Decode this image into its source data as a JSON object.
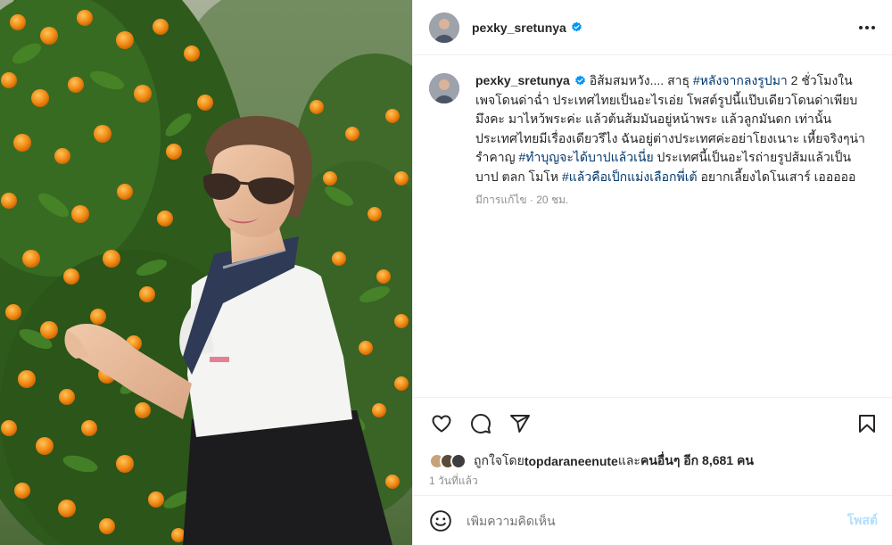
{
  "post": {
    "username": "pexky_sretunya",
    "verified": true
  },
  "caption": {
    "username": "pexky_sretunya",
    "seg1": " อิส้มสมหวัง.... สาธุ ",
    "tag1": "#หลังจากลงรูปมา",
    "seg2": " 2 ชั่วโมงในเพจโดนด่าฉ่ำ ประเทศไทยเป็นอะไรเอ่ย โพสต์รูปนี้แป๊บเดียวโดนด่าเพียบ มึงคะ มาไหว้พระค่ะ แล้วต้นส้มมันอยู่หน้าพระ แล้วลูกมันดก เท่านั้น ประเทศไทยมีเรื่องเดียวรึไง ฉันอยู่ต่างประเทศค่ะอย่าโยงเนาะ เหี้ยจริงๆน่ารำคาญ ",
    "tag2": "#ทำบุญจะได้บาปแล้วเนี่ย",
    "seg3": " ประเทศนี้เป็นอะไรถ่ายรูปส้มแล้วเป็นบาป ตลก โมโห ",
    "tag3": "#แล้วคือเป็กแม่งเลือกพี่เต้",
    "seg4": " อยากเลี้ยงไดโนเสาร์ เอออออ",
    "edited_meta": "มีการแก้ไข · 20 ชม."
  },
  "actions": {
    "like_icon": "heart-icon",
    "comment_icon": "comment-icon",
    "share_icon": "share-icon",
    "save_icon": "bookmark-icon"
  },
  "likes": {
    "prefix": "ถูกใจโดย ",
    "user": "topdaraneenute",
    "mid": " และ",
    "others": "คนอื่นๆ อีก 8,681 คน",
    "avatar_colors": [
      "#c9a27a",
      "#5a4a3a",
      "#3d3d3d"
    ]
  },
  "timestamp": "1 วันที่แล้ว",
  "comment": {
    "placeholder": "เพิ่มความคิดเห็น",
    "post_label": "โพสต์"
  },
  "colors": {
    "hashtag": "#00376b",
    "verified": "#0095f6",
    "post_button_disabled": "#b2dffc"
  }
}
